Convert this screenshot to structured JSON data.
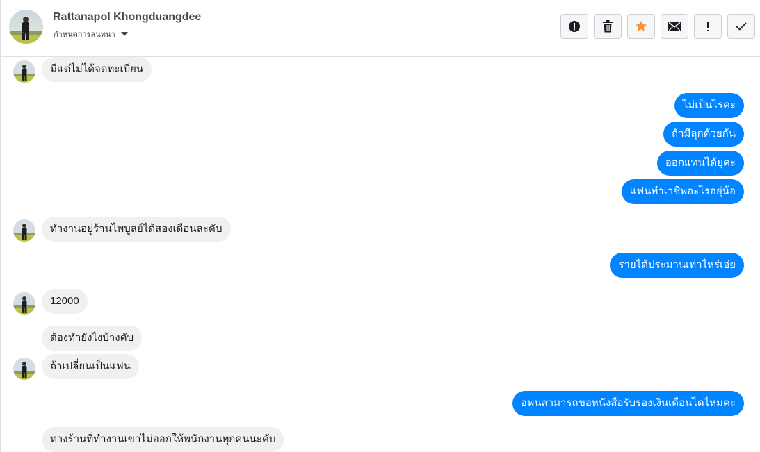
{
  "contact": {
    "name": "Rattanapol Khongduangdee",
    "subtitle": "กำหนดการสนทนา"
  },
  "toolbar": {
    "buttons": [
      {
        "icon": "alert-circle-icon",
        "label": "Mark as spam"
      },
      {
        "icon": "trash-icon",
        "label": "Delete"
      },
      {
        "icon": "star-icon",
        "label": "Star",
        "color": "#f7923b"
      },
      {
        "icon": "envelope-icon",
        "label": "Mark as unread"
      },
      {
        "icon": "exclamation-icon",
        "label": "Follow up"
      },
      {
        "icon": "checkmark-icon",
        "label": "Mark as done"
      }
    ]
  },
  "colors": {
    "outgoing_bubble": "#0084ff",
    "incoming_bubble": "#f1f0f0",
    "star": "#f7923b"
  },
  "messages": [
    {
      "dir": "in",
      "text": "มีแต่ไม่ได้จดทะเบียน",
      "avatar": true
    },
    {
      "dir": "out",
      "text": "ไม่เป็นไรคะ"
    },
    {
      "dir": "out",
      "text": "ถ้ามีลุกด้วยกัน"
    },
    {
      "dir": "out",
      "text": "ออกแทนได้ยุคะ"
    },
    {
      "dir": "out",
      "text": "แฟนทำเาชีพอะไรอยุ่น้อ"
    },
    {
      "dir": "in",
      "text": "ทำงานอยู่ร้านไพบูลย์ได้สองเดือนละคับ",
      "avatar": true
    },
    {
      "dir": "out",
      "text": "รายได้ประมานเท่าไหร่เอ่ย"
    },
    {
      "dir": "in",
      "text": "12000",
      "avatar": true
    },
    {
      "dir": "in",
      "text": "ต้องทำยังไงบ้างคับ",
      "avatar": false
    },
    {
      "dir": "in",
      "text": "ถ้าเปลี่ยนเป็นแฟน",
      "avatar": true
    },
    {
      "dir": "out",
      "text": "อฟนสามารถขอหนังสือรับรองเงินเดือนไดไหมคะ"
    },
    {
      "dir": "in",
      "text": "ทางร้านที่ทำงานเขาไม่ออกให้พนักงานทุกคนนะคับ",
      "avatar": false
    }
  ]
}
